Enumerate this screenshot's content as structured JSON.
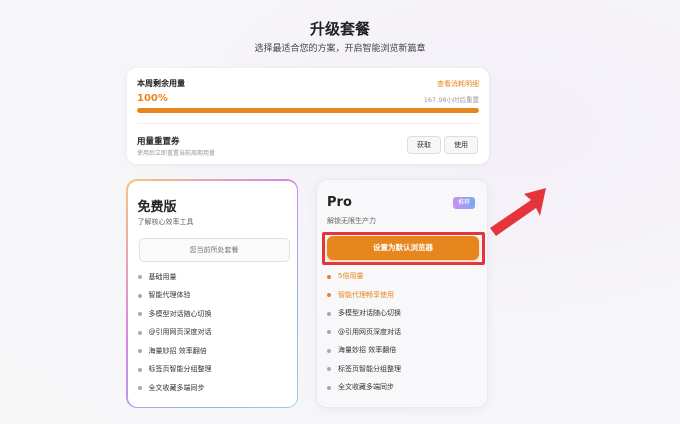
{
  "header": {
    "title": "升级套餐",
    "subtitle": "选择最适合您的方案，开启智能浏览新篇章"
  },
  "usage": {
    "label": "本周剩余用量",
    "detail_link": "查看消耗明细",
    "percent_text": "100%",
    "remaining_fraction": 1.0,
    "reset_text": "167.98小时后重置"
  },
  "reset_voucher": {
    "title": "用量重置券",
    "description": "使用后立即重置当前周期用量",
    "get_label": "获取",
    "use_label": "使用"
  },
  "plans": {
    "free": {
      "name": "免费版",
      "tagline": "了解核心效率工具",
      "current_label": "您当前所处套餐",
      "features": [
        "基础用量",
        "智能代理体验",
        "多模型对话随心切换",
        "@引用网页深度对话",
        "海量妙招 效率翻倍",
        "标签页智能分组整理",
        "全文收藏多端同步"
      ]
    },
    "pro": {
      "name": "Pro",
      "badge": "推荐",
      "tagline": "解锁无限生产力",
      "cta_label": "设置为默认浏览器",
      "features": [
        "5倍用量",
        "智能代理畅享使用",
        "多模型对话随心切换",
        "@引用网页深度对话",
        "海量妙招 效率翻倍",
        "标签页智能分组整理",
        "全文收藏多端同步"
      ],
      "highlighted_count": 2
    }
  },
  "colors": {
    "accent": "#e8861e",
    "annotation_red": "#e6343c"
  }
}
